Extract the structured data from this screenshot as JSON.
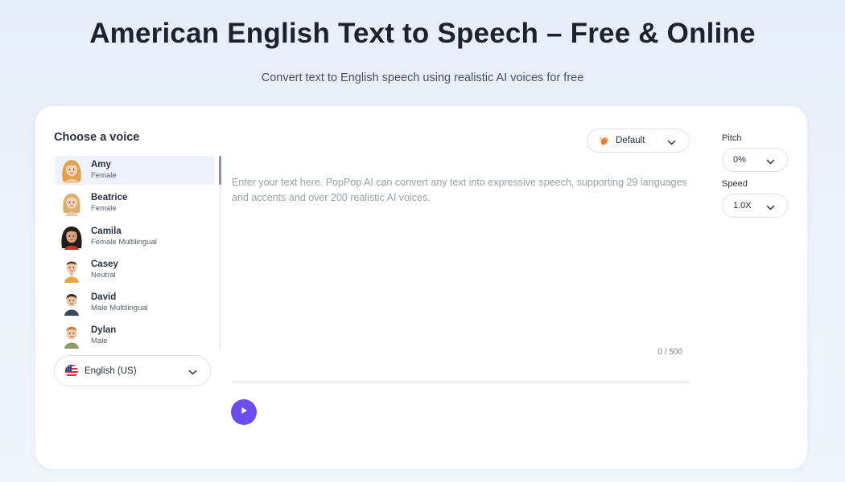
{
  "header": {
    "title": "American English Text to Speech – Free & Online",
    "subtitle": "Convert text to English speech using realistic AI voices for free"
  },
  "voice_panel": {
    "title": "Choose a voice",
    "voices": [
      {
        "name": "Amy",
        "desc": "Female",
        "selected": true
      },
      {
        "name": "Beatrice",
        "desc": "Female",
        "selected": false
      },
      {
        "name": "Camila",
        "desc": "Female Multilingual",
        "selected": false
      },
      {
        "name": "Casey",
        "desc": "Neutral",
        "selected": false
      },
      {
        "name": "David",
        "desc": "Male Multilingual",
        "selected": false
      },
      {
        "name": "Dylan",
        "desc": "Male",
        "selected": false
      }
    ],
    "language": {
      "label": "English (US)",
      "icon": "us-flag-icon"
    }
  },
  "editor": {
    "style_select": {
      "label": "Default",
      "icon": "hand-wave-icon"
    },
    "placeholder": "Enter your text here. PopPop AI can convert any text into expressive speech, supporting 29 languages and accents and over 200 realistic AI voices.",
    "value": "",
    "char_count": "0 / 500",
    "play_icon": "play-icon"
  },
  "settings": {
    "pitch": {
      "label": "Pitch",
      "value": "0%"
    },
    "speed": {
      "label": "Speed",
      "value": "1.0X"
    }
  },
  "colors": {
    "accent": "#6d4df2",
    "selected_voice_bg": "#eef2fd",
    "background": "#e9f0fb"
  }
}
